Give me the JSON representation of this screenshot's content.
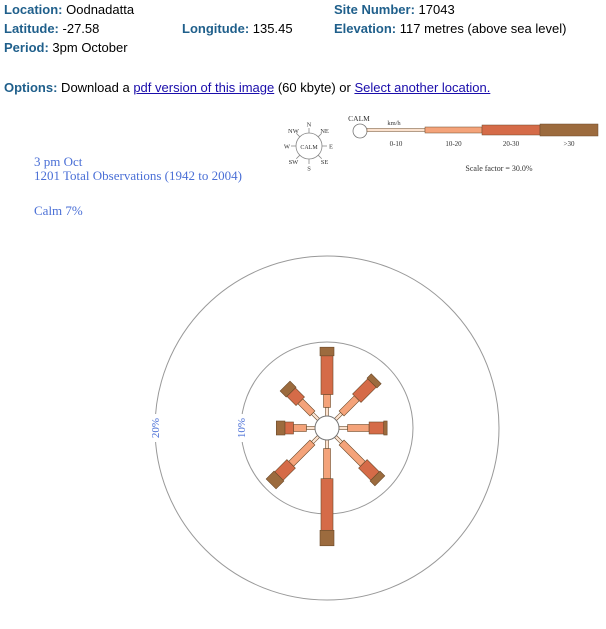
{
  "header": {
    "location_label": "Location:",
    "location": "Oodnadatta",
    "site_label": "Site Number:",
    "site": "17043",
    "latitude_label": "Latitude:",
    "latitude": "-27.58",
    "longitude_label": "Longitude:",
    "longitude": "135.45",
    "elevation_label": "Elevation:",
    "elevation": "117 metres (above sea level)",
    "period_label": "Period:",
    "period": "3pm October"
  },
  "options": {
    "label": "Options:",
    "text1": " Download a ",
    "pdf_link": "pdf version of this image",
    "text2": " (60 kbyte) or ",
    "select_link": "Select another location."
  },
  "colors": {
    "text_blue": "#4a6fd6",
    "label_teal": "#1f5f8b",
    "link": "#1a0dab"
  },
  "chart_data": {
    "type": "wind_rose",
    "title_line1": "3 pm Oct",
    "title_line2": "1201 Total Observations (1942 to 2004)",
    "calm": "Calm 7%",
    "rings": [
      {
        "value": 10,
        "label": "10%"
      },
      {
        "value": 20,
        "label": "20%"
      }
    ],
    "directions": [
      "N",
      "NE",
      "E",
      "SE",
      "S",
      "SW",
      "W",
      "NW"
    ],
    "speed_classes": [
      "0-10",
      "10-20",
      "20-30",
      ">30"
    ],
    "speed_colors": [
      "#fbe2cf",
      "#f4a37a",
      "#d56b48",
      "#9c6b3e"
    ],
    "units": "km/h",
    "scale_factor": "Scale factor = 30.0%",
    "calm_label": "CALM",
    "series": [
      {
        "direction": "N",
        "values": [
          1.0,
          1.5,
          4.5,
          1.0
        ]
      },
      {
        "direction": "NE",
        "values": [
          1.0,
          2.5,
          2.5,
          0.7
        ]
      },
      {
        "direction": "E",
        "values": [
          1.0,
          2.5,
          1.7,
          0.4
        ]
      },
      {
        "direction": "SE",
        "values": [
          1.0,
          3.5,
          2.0,
          0.8
        ]
      },
      {
        "direction": "S",
        "values": [
          1.0,
          3.5,
          6.0,
          1.8
        ]
      },
      {
        "direction": "SW",
        "values": [
          1.0,
          3.5,
          2.0,
          1.3
        ]
      },
      {
        "direction": "W",
        "values": [
          1.0,
          1.5,
          1.0,
          1.0
        ]
      },
      {
        "direction": "NW",
        "values": [
          1.0,
          2.0,
          1.5,
          1.0
        ]
      }
    ]
  }
}
